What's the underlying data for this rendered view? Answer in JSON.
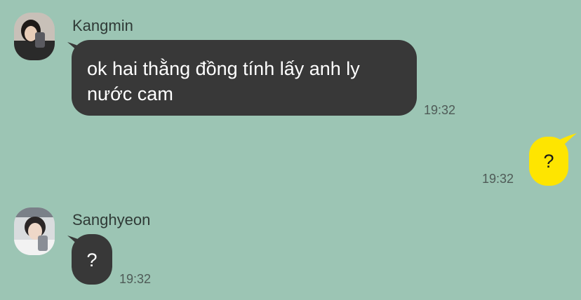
{
  "messages": [
    {
      "sender": "Kangmin",
      "avatar_icon": "profile-photo-icon",
      "text": "ok hai thằng đồng tính lấy anh ly nước cam",
      "time": "19:32"
    },
    {
      "sender": "",
      "text": "?",
      "time": "19:32"
    },
    {
      "sender": "Sanghyeon",
      "avatar_icon": "profile-photo-icon",
      "text": "?",
      "time": "19:32"
    }
  ],
  "colors": {
    "background": "#9cc5b4",
    "incoming_bubble": "#383838",
    "outgoing_bubble": "#fee500"
  }
}
